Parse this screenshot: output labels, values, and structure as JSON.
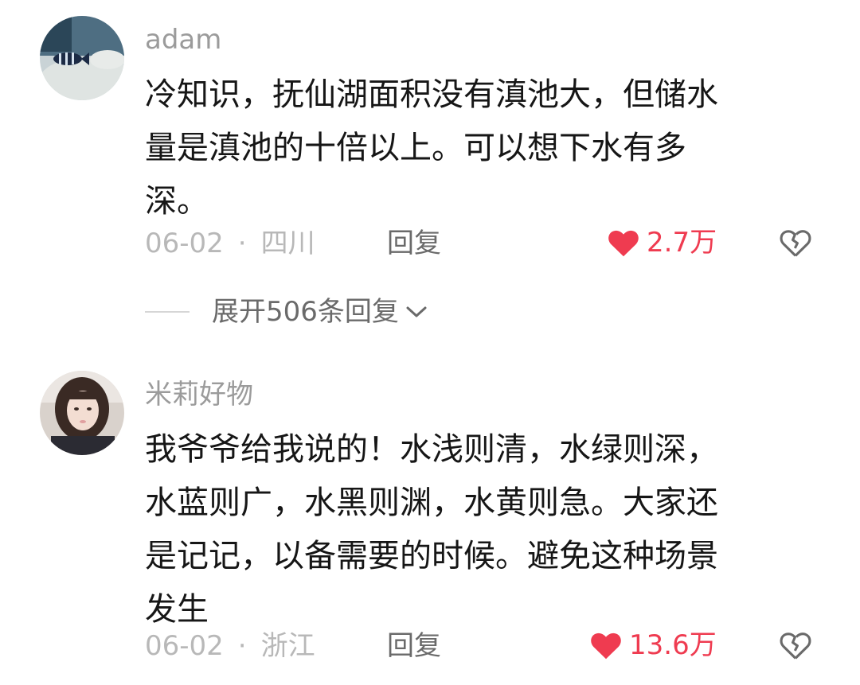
{
  "colors": {
    "accent_like": "#ef3b50",
    "username": "#9b9b9b",
    "meta": "#b8b8b8",
    "body_text": "#161616"
  },
  "comments": [
    {
      "username": "adam",
      "avatar_icon": "fish-avatar",
      "text_lines": [
        "冷知识，抚仙湖面积没有滇池大，但储水",
        "量是滇池的十倍以上。可以想下水有多",
        "深。"
      ],
      "date": "06-02",
      "separator": "·",
      "location": "四川",
      "reply_label": "回复",
      "likes": "2.7万",
      "like_icon": "heart-filled-icon",
      "dislike_icon": "broken-heart-icon",
      "expand_replies_label": "展开506条回复"
    },
    {
      "username": "米莉好物",
      "avatar_icon": "girl-portrait-avatar",
      "text_lines": [
        "我爷爷给我说的！水浅则清，水绿则深，",
        "水蓝则广，水黑则渊，水黄则急。大家还",
        "是记记，以备需要的时候。避免这种场景",
        "发生"
      ],
      "date": "06-02",
      "separator": "·",
      "location": "浙江",
      "reply_label": "回复",
      "likes": "13.6万",
      "like_icon": "heart-filled-icon",
      "dislike_icon": "broken-heart-icon"
    }
  ]
}
